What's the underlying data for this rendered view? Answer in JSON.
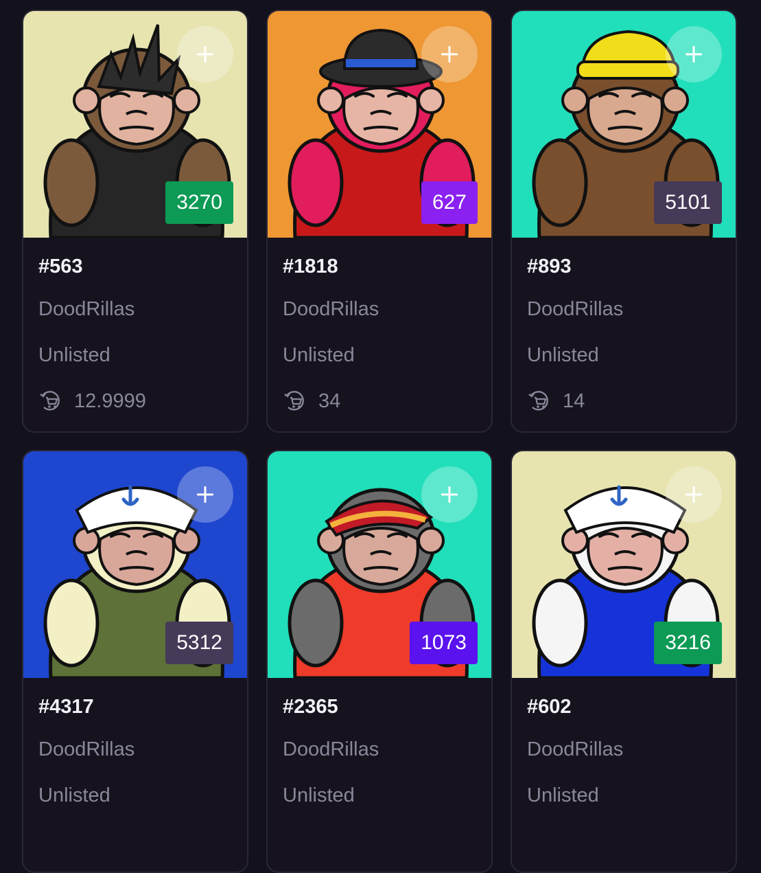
{
  "cards": [
    {
      "token": "#563",
      "collection": "DoodRillas",
      "status": "Unlisted",
      "last_sale": "12.9999",
      "rank": "3270",
      "rank_color": "#0c9a55",
      "bg": "#e7e4b0",
      "skin": "#7b5a3c",
      "face": "#e0b29f",
      "outfit": "#262626",
      "hat": "mohawk",
      "hat_color": "#2c2c2c"
    },
    {
      "token": "#1818",
      "collection": "DoodRillas",
      "status": "Unlisted",
      "last_sale": "34",
      "rank": "627",
      "rank_color": "#8a21f0",
      "bg": "#ee9733",
      "skin": "#e21d5c",
      "face": "#e6b5a5",
      "outfit": "#c8191a",
      "hat": "bowler",
      "hat_color": "#2b2b2b"
    },
    {
      "token": "#893",
      "collection": "DoodRillas",
      "status": "Unlisted",
      "last_sale": "14",
      "rank": "5101",
      "rank_color": "#453a57",
      "bg": "#20dfba",
      "skin": "#7a4f2d",
      "face": "#d8a98f",
      "outfit": "#7a4f2d",
      "hat": "beanie",
      "hat_color": "#f2dd1a"
    },
    {
      "token": "#4317",
      "collection": "DoodRillas",
      "status": "Unlisted",
      "last_sale": "",
      "rank": "5312",
      "rank_color": "#453a57",
      "bg": "#1e46cf",
      "skin": "#f3f0c6",
      "face": "#d9a79a",
      "outfit": "#5d7138",
      "hat": "sailor",
      "hat_color": "#ffffff"
    },
    {
      "token": "#2365",
      "collection": "DoodRillas",
      "status": "Unlisted",
      "last_sale": "",
      "rank": "1073",
      "rank_color": "#5a12ee",
      "bg": "#20dfba",
      "skin": "#6b6b6b",
      "face": "#d8a99a",
      "outfit": "#ef3b2a",
      "hat": "visor",
      "hat_color": "#c21b27"
    },
    {
      "token": "#602",
      "collection": "DoodRillas",
      "status": "Unlisted",
      "last_sale": "",
      "rank": "3216",
      "rank_color": "#0c9a55",
      "bg": "#e7e4b0",
      "skin": "#f5f5f5",
      "face": "#e4b0a5",
      "outfit": "#1533d8",
      "hat": "sailor",
      "hat_color": "#ffffff"
    }
  ]
}
